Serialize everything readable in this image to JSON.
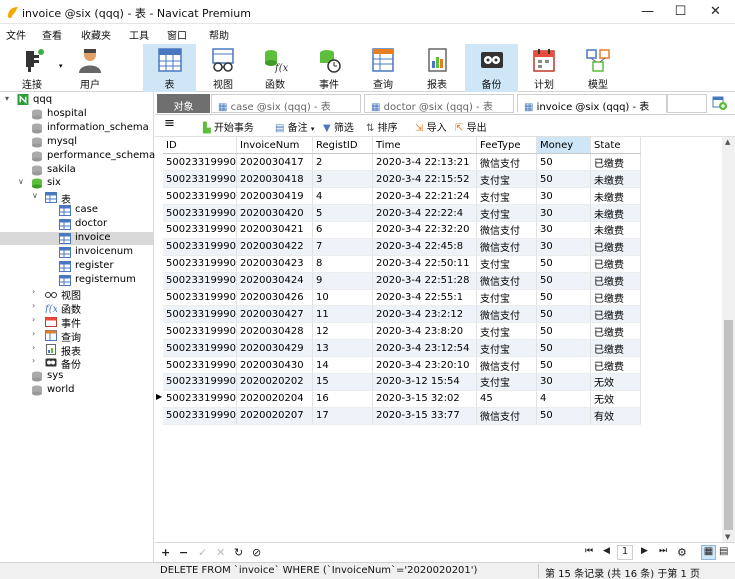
{
  "window": {
    "title": "invoice @six (qqq) - 表 - Navicat Premium",
    "controls": {
      "minimize": "—",
      "maximize": "☐",
      "close": "✕"
    }
  },
  "menu": [
    "文件",
    "查看",
    "收藏夹",
    "工具",
    "窗口",
    "帮助"
  ],
  "toolbar": [
    {
      "label": "连接",
      "icon": "connection-icon"
    },
    {
      "label": "用户",
      "icon": "user-icon"
    },
    {
      "label": "表",
      "icon": "table-icon",
      "selected": true
    },
    {
      "label": "视图",
      "icon": "view-icon"
    },
    {
      "label": "函数",
      "icon": "function-icon"
    },
    {
      "label": "事件",
      "icon": "event-icon"
    },
    {
      "label": "查询",
      "icon": "query-icon"
    },
    {
      "label": "报表",
      "icon": "report-icon"
    },
    {
      "label": "备份",
      "icon": "backup-icon",
      "selected": true
    },
    {
      "label": "计划",
      "icon": "schedule-icon"
    },
    {
      "label": "模型",
      "icon": "model-icon"
    }
  ],
  "sidebar": {
    "connection": "qqq",
    "databases_top": [
      "hospital",
      "information_schema",
      "mysql",
      "performance_schema",
      "sakila"
    ],
    "open_db": "six",
    "tables_group": "表",
    "tables": [
      "case",
      "doctor",
      "invoice",
      "invoicenum",
      "register",
      "registernum"
    ],
    "selected_table": "invoice",
    "groups": [
      "视图",
      "函数",
      "事件",
      "查询",
      "报表",
      "备份"
    ],
    "databases_bottom": [
      "sys",
      "world"
    ]
  },
  "tabs": {
    "object": "对象",
    "items": [
      {
        "label": "case @six (qqq) - 表",
        "active": false
      },
      {
        "label": "doctor @six (qqq) - 表",
        "active": false
      },
      {
        "label": "invoice @six (qqq) - 表",
        "active": true
      }
    ]
  },
  "datatoolbar": {
    "menu_icon": "≡",
    "begin_tx": "开始事务",
    "memo": "备注",
    "filter": "筛选",
    "sort": "排序",
    "import": "导入",
    "export": "导出"
  },
  "grid": {
    "columns": [
      "ID",
      "InvoiceNum",
      "RegistID",
      "Time",
      "FeeType",
      "Money",
      "State"
    ],
    "rows": [
      [
        "50023319990",
        "2020030417",
        "2",
        "2020-3-4 22:13:21",
        "微信支付",
        "50",
        "已缴费"
      ],
      [
        "50023319990",
        "2020030418",
        "3",
        "2020-3-4 22:15:52",
        "支付宝",
        "50",
        "未缴费"
      ],
      [
        "50023319990",
        "2020030419",
        "4",
        "2020-3-4 22:21:24",
        "支付宝",
        "30",
        "未缴费"
      ],
      [
        "50023319990",
        "2020030420",
        "5",
        "2020-3-4 22:22:4",
        "支付宝",
        "30",
        "未缴费"
      ],
      [
        "50023319990",
        "2020030421",
        "6",
        "2020-3-4 22:32:20",
        "微信支付",
        "30",
        "未缴费"
      ],
      [
        "50023319990",
        "2020030422",
        "7",
        "2020-3-4 22:45:8",
        "微信支付",
        "30",
        "已缴费"
      ],
      [
        "50023319990",
        "2020030423",
        "8",
        "2020-3-4 22:50:11",
        "支付宝",
        "50",
        "已缴费"
      ],
      [
        "50023319990",
        "2020030424",
        "9",
        "2020-3-4 22:51:28",
        "微信支付",
        "50",
        "已缴费"
      ],
      [
        "50023319990",
        "2020030426",
        "10",
        "2020-3-4 22:55:1",
        "支付宝",
        "50",
        "已缴费"
      ],
      [
        "50023319990",
        "2020030427",
        "11",
        "2020-3-4 23:2:12",
        "微信支付",
        "50",
        "已缴费"
      ],
      [
        "50023319990",
        "2020030428",
        "12",
        "2020-3-4 23:8:20",
        "支付宝",
        "50",
        "已缴费"
      ],
      [
        "50023319990",
        "2020030429",
        "13",
        "2020-3-4 23:12:54",
        "支付宝",
        "50",
        "已缴费"
      ],
      [
        "50023319990",
        "2020030430",
        "14",
        "2020-3-4 23:20:10",
        "微信支付",
        "50",
        "已缴费"
      ],
      [
        "50023319990",
        "2020020202",
        "15",
        "2020-3-12 15:54",
        "支付宝",
        "30",
        "无效"
      ],
      [
        "50023319990",
        "2020020204",
        "16",
        "2020-3-15 32:02",
        "45",
        "4",
        "无效"
      ],
      [
        "50023319990",
        "2020020207",
        "17",
        "2020-3-15 33:77",
        "微信支付",
        "50",
        "有效"
      ]
    ],
    "current_row_index": 14
  },
  "bottombar": {
    "add": "+",
    "remove": "−",
    "apply": "✓",
    "discard": "✕",
    "refresh": "↻",
    "stop": "⊘",
    "page": "1"
  },
  "status": {
    "sql": "DELETE FROM `invoice` WHERE (`InvoiceNum`='2020020201')",
    "records": "第 15 条记录 (共 16 条) 于第 1 页"
  }
}
